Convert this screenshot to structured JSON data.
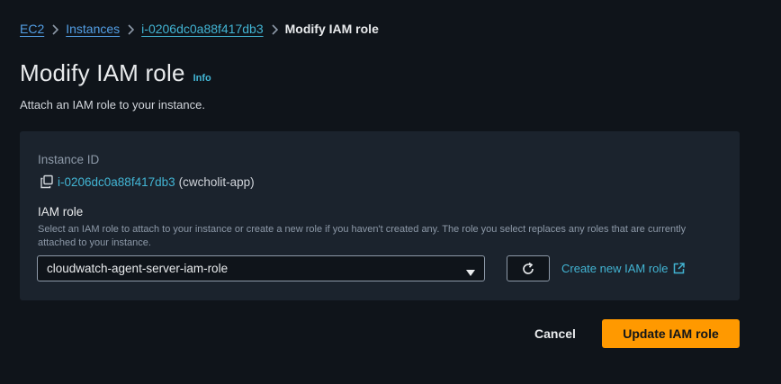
{
  "breadcrumb": {
    "items": [
      {
        "label": "EC2",
        "link": true
      },
      {
        "label": "Instances",
        "link": true
      },
      {
        "label": "i-0206dc0a88f417db3",
        "link": true
      },
      {
        "label": "Modify IAM role",
        "link": false
      }
    ]
  },
  "header": {
    "title": "Modify IAM role",
    "info_label": "Info",
    "subtitle": "Attach an IAM role to your instance."
  },
  "form": {
    "instance_id_label": "Instance ID",
    "instance_id": "i-0206dc0a88f417db3",
    "instance_name": "(cwcholit-app)",
    "iam_role_label": "IAM role",
    "iam_role_description": "Select an IAM role to attach to your instance or create a new role if you haven't created any. The role you select replaces any roles that are currently attached to your instance.",
    "selected_role": "cloudwatch-agent-server-iam-role",
    "create_role_label": "Create new IAM role"
  },
  "actions": {
    "cancel_label": "Cancel",
    "submit_label": "Update IAM role"
  },
  "colors": {
    "background": "#0f141a",
    "panel": "#1b232d",
    "link": "#42b4d3",
    "primary_button": "#ff9900"
  },
  "icons": {
    "breadcrumb_separator": "chevron-right-icon",
    "copy": "copy-icon",
    "select_caret": "caret-down-icon",
    "refresh": "refresh-icon",
    "external": "external-link-icon"
  }
}
